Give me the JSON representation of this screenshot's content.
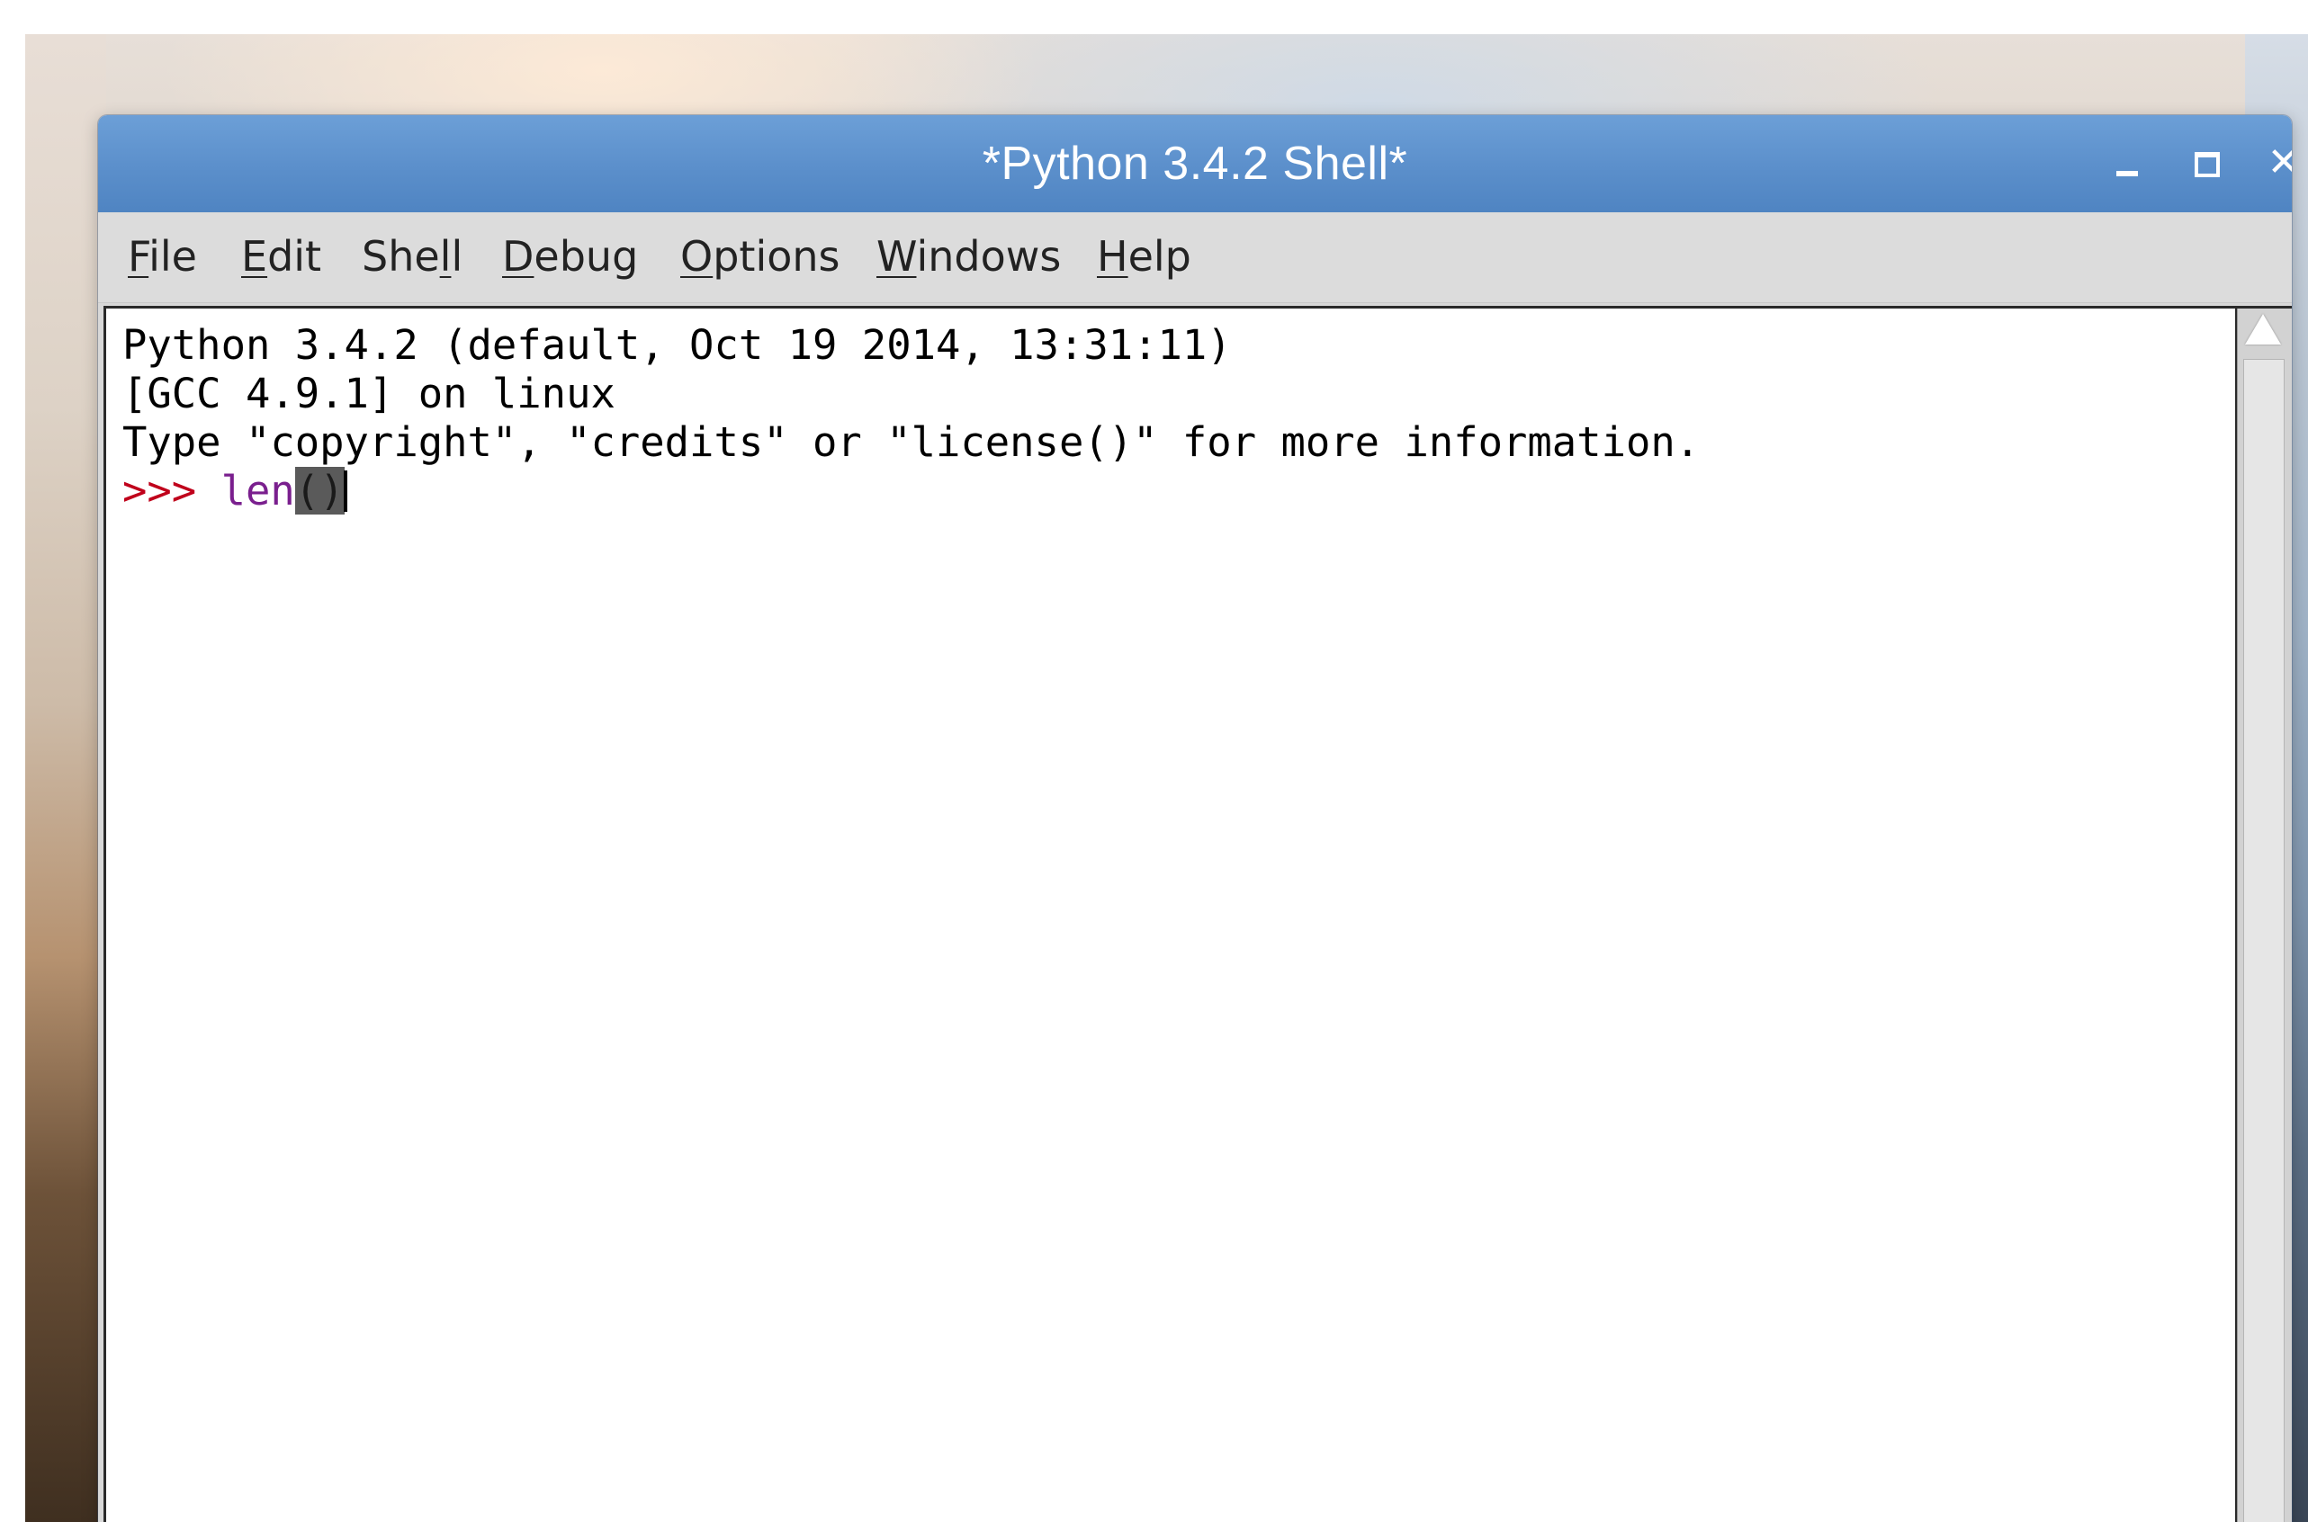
{
  "window": {
    "title": "*Python 3.4.2 Shell*",
    "controls": {
      "minimize_icon": "minimize-icon",
      "maximize_icon": "maximize-icon",
      "close_icon": "close-icon"
    }
  },
  "menubar": {
    "items": [
      {
        "pre": "",
        "accel": "F",
        "post": "ile"
      },
      {
        "pre": "",
        "accel": "E",
        "post": "dit"
      },
      {
        "pre": "She",
        "accel": "l",
        "post": "l"
      },
      {
        "pre": "",
        "accel": "D",
        "post": "ebug"
      },
      {
        "pre": "",
        "accel": "O",
        "post": "ptions"
      },
      {
        "pre": "",
        "accel": "W",
        "post": "indows"
      },
      {
        "pre": "",
        "accel": "H",
        "post": "elp"
      }
    ]
  },
  "shell": {
    "lines": [
      "Python 3.4.2 (default, Oct 19 2014, 13:31:11)",
      "[GCC 4.9.1] on linux",
      "Type \"copyright\", \"credits\" or \"license()\" for more information."
    ],
    "prompt": ">>> ",
    "input_typed": "len",
    "input_parens": "()"
  },
  "colors": {
    "titlebar": "#5b8fcb",
    "prompt": "#c0001b",
    "input": "#7a1f8e",
    "paren_highlight": "#5a5a5a"
  }
}
